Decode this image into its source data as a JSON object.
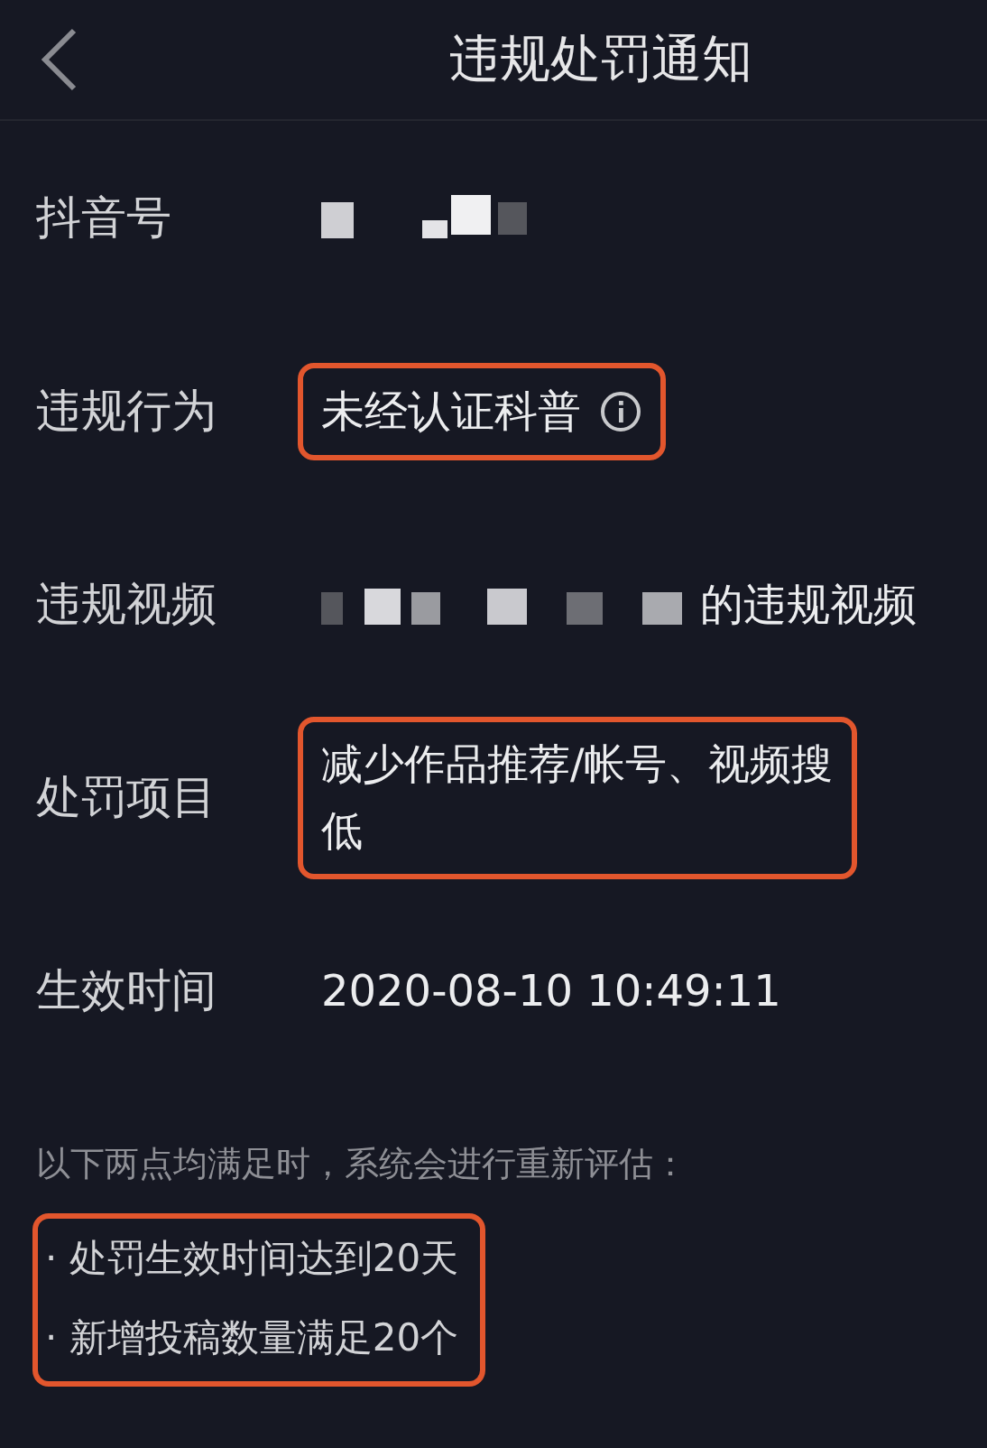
{
  "header": {
    "title": "违规处罚通知"
  },
  "rows": [
    {
      "kind": "masked",
      "label": "抖音号",
      "highlighted": false
    },
    {
      "kind": "text",
      "label": "违规行为",
      "value": "未经认证科普",
      "info": true,
      "highlighted": true
    },
    {
      "kind": "masked",
      "label": "违规视频",
      "value": "的违规视频",
      "highlighted": false
    },
    {
      "kind": "lines",
      "label": "处罚项目",
      "lines": [
        "减少作品推荐/帐号、视频搜",
        "低"
      ],
      "highlighted": true
    },
    {
      "kind": "text",
      "label": "生效时间",
      "value": "2020-08-10 10:49:11",
      "info": false,
      "highlighted": false
    }
  ],
  "note": {
    "text": "以下两点均满足时，系统会进行重新评估：",
    "bullets": [
      "· 处罚生效时间达到20天",
      "· 新增投稿数量满足20个"
    ],
    "highlighted": true
  }
}
